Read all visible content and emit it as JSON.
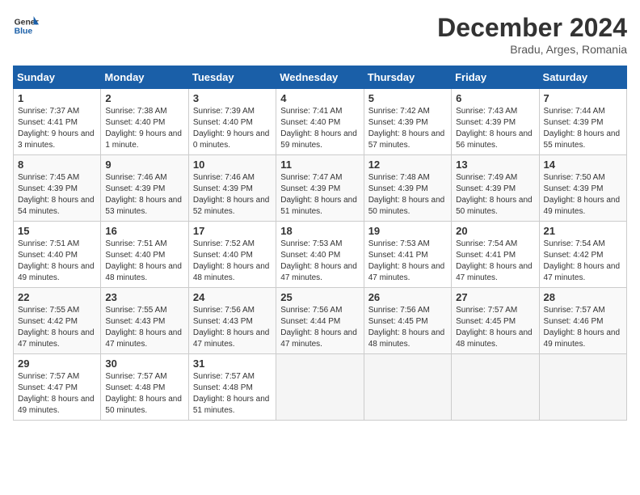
{
  "header": {
    "logo_line1": "General",
    "logo_line2": "Blue",
    "month_title": "December 2024",
    "subtitle": "Bradu, Arges, Romania"
  },
  "weekdays": [
    "Sunday",
    "Monday",
    "Tuesday",
    "Wednesday",
    "Thursday",
    "Friday",
    "Saturday"
  ],
  "weeks": [
    [
      {
        "day": "1",
        "sunrise": "Sunrise: 7:37 AM",
        "sunset": "Sunset: 4:41 PM",
        "daylight": "Daylight: 9 hours and 3 minutes."
      },
      {
        "day": "2",
        "sunrise": "Sunrise: 7:38 AM",
        "sunset": "Sunset: 4:40 PM",
        "daylight": "Daylight: 9 hours and 1 minute."
      },
      {
        "day": "3",
        "sunrise": "Sunrise: 7:39 AM",
        "sunset": "Sunset: 4:40 PM",
        "daylight": "Daylight: 9 hours and 0 minutes."
      },
      {
        "day": "4",
        "sunrise": "Sunrise: 7:41 AM",
        "sunset": "Sunset: 4:40 PM",
        "daylight": "Daylight: 8 hours and 59 minutes."
      },
      {
        "day": "5",
        "sunrise": "Sunrise: 7:42 AM",
        "sunset": "Sunset: 4:39 PM",
        "daylight": "Daylight: 8 hours and 57 minutes."
      },
      {
        "day": "6",
        "sunrise": "Sunrise: 7:43 AM",
        "sunset": "Sunset: 4:39 PM",
        "daylight": "Daylight: 8 hours and 56 minutes."
      },
      {
        "day": "7",
        "sunrise": "Sunrise: 7:44 AM",
        "sunset": "Sunset: 4:39 PM",
        "daylight": "Daylight: 8 hours and 55 minutes."
      }
    ],
    [
      {
        "day": "8",
        "sunrise": "Sunrise: 7:45 AM",
        "sunset": "Sunset: 4:39 PM",
        "daylight": "Daylight: 8 hours and 54 minutes."
      },
      {
        "day": "9",
        "sunrise": "Sunrise: 7:46 AM",
        "sunset": "Sunset: 4:39 PM",
        "daylight": "Daylight: 8 hours and 53 minutes."
      },
      {
        "day": "10",
        "sunrise": "Sunrise: 7:46 AM",
        "sunset": "Sunset: 4:39 PM",
        "daylight": "Daylight: 8 hours and 52 minutes."
      },
      {
        "day": "11",
        "sunrise": "Sunrise: 7:47 AM",
        "sunset": "Sunset: 4:39 PM",
        "daylight": "Daylight: 8 hours and 51 minutes."
      },
      {
        "day": "12",
        "sunrise": "Sunrise: 7:48 AM",
        "sunset": "Sunset: 4:39 PM",
        "daylight": "Daylight: 8 hours and 50 minutes."
      },
      {
        "day": "13",
        "sunrise": "Sunrise: 7:49 AM",
        "sunset": "Sunset: 4:39 PM",
        "daylight": "Daylight: 8 hours and 50 minutes."
      },
      {
        "day": "14",
        "sunrise": "Sunrise: 7:50 AM",
        "sunset": "Sunset: 4:39 PM",
        "daylight": "Daylight: 8 hours and 49 minutes."
      }
    ],
    [
      {
        "day": "15",
        "sunrise": "Sunrise: 7:51 AM",
        "sunset": "Sunset: 4:40 PM",
        "daylight": "Daylight: 8 hours and 49 minutes."
      },
      {
        "day": "16",
        "sunrise": "Sunrise: 7:51 AM",
        "sunset": "Sunset: 4:40 PM",
        "daylight": "Daylight: 8 hours and 48 minutes."
      },
      {
        "day": "17",
        "sunrise": "Sunrise: 7:52 AM",
        "sunset": "Sunset: 4:40 PM",
        "daylight": "Daylight: 8 hours and 48 minutes."
      },
      {
        "day": "18",
        "sunrise": "Sunrise: 7:53 AM",
        "sunset": "Sunset: 4:40 PM",
        "daylight": "Daylight: 8 hours and 47 minutes."
      },
      {
        "day": "19",
        "sunrise": "Sunrise: 7:53 AM",
        "sunset": "Sunset: 4:41 PM",
        "daylight": "Daylight: 8 hours and 47 minutes."
      },
      {
        "day": "20",
        "sunrise": "Sunrise: 7:54 AM",
        "sunset": "Sunset: 4:41 PM",
        "daylight": "Daylight: 8 hours and 47 minutes."
      },
      {
        "day": "21",
        "sunrise": "Sunrise: 7:54 AM",
        "sunset": "Sunset: 4:42 PM",
        "daylight": "Daylight: 8 hours and 47 minutes."
      }
    ],
    [
      {
        "day": "22",
        "sunrise": "Sunrise: 7:55 AM",
        "sunset": "Sunset: 4:42 PM",
        "daylight": "Daylight: 8 hours and 47 minutes."
      },
      {
        "day": "23",
        "sunrise": "Sunrise: 7:55 AM",
        "sunset": "Sunset: 4:43 PM",
        "daylight": "Daylight: 8 hours and 47 minutes."
      },
      {
        "day": "24",
        "sunrise": "Sunrise: 7:56 AM",
        "sunset": "Sunset: 4:43 PM",
        "daylight": "Daylight: 8 hours and 47 minutes."
      },
      {
        "day": "25",
        "sunrise": "Sunrise: 7:56 AM",
        "sunset": "Sunset: 4:44 PM",
        "daylight": "Daylight: 8 hours and 47 minutes."
      },
      {
        "day": "26",
        "sunrise": "Sunrise: 7:56 AM",
        "sunset": "Sunset: 4:45 PM",
        "daylight": "Daylight: 8 hours and 48 minutes."
      },
      {
        "day": "27",
        "sunrise": "Sunrise: 7:57 AM",
        "sunset": "Sunset: 4:45 PM",
        "daylight": "Daylight: 8 hours and 48 minutes."
      },
      {
        "day": "28",
        "sunrise": "Sunrise: 7:57 AM",
        "sunset": "Sunset: 4:46 PM",
        "daylight": "Daylight: 8 hours and 49 minutes."
      }
    ],
    [
      {
        "day": "29",
        "sunrise": "Sunrise: 7:57 AM",
        "sunset": "Sunset: 4:47 PM",
        "daylight": "Daylight: 8 hours and 49 minutes."
      },
      {
        "day": "30",
        "sunrise": "Sunrise: 7:57 AM",
        "sunset": "Sunset: 4:48 PM",
        "daylight": "Daylight: 8 hours and 50 minutes."
      },
      {
        "day": "31",
        "sunrise": "Sunrise: 7:57 AM",
        "sunset": "Sunset: 4:48 PM",
        "daylight": "Daylight: 8 hours and 51 minutes."
      },
      null,
      null,
      null,
      null
    ]
  ]
}
